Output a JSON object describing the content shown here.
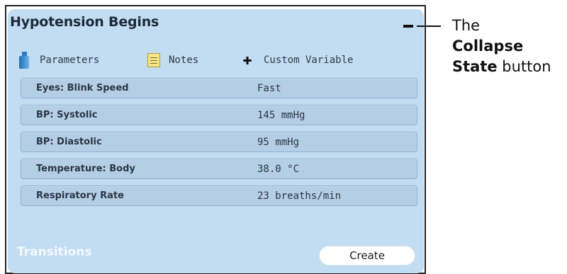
{
  "state": {
    "title": "Hypotension Begins",
    "collapse_icon": "collapse-minus-icon"
  },
  "toolbar": {
    "parameters": "Parameters",
    "notes": "Notes",
    "custom_variable": "Custom Variable"
  },
  "parameters": [
    {
      "name": "Eyes: Blink Speed",
      "value": "Fast"
    },
    {
      "name": "BP: Systolic",
      "value": "145 mmHg"
    },
    {
      "name": "BP: Diastolic",
      "value": "95 mmHg"
    },
    {
      "name": "Temperature: Body",
      "value": "38.0 °C"
    },
    {
      "name": "Respiratory Rate",
      "value": "23 breaths/min"
    }
  ],
  "transitions": {
    "label": "Transitions",
    "create_label": "Create"
  },
  "callout": {
    "line1": "The",
    "line2": "Collapse",
    "line3_bold": "State",
    "line3_rest": " button"
  },
  "colors": {
    "panel": "#c2dcf1",
    "row": "#b4cee6",
    "accent_text": "#f4f9ff"
  }
}
